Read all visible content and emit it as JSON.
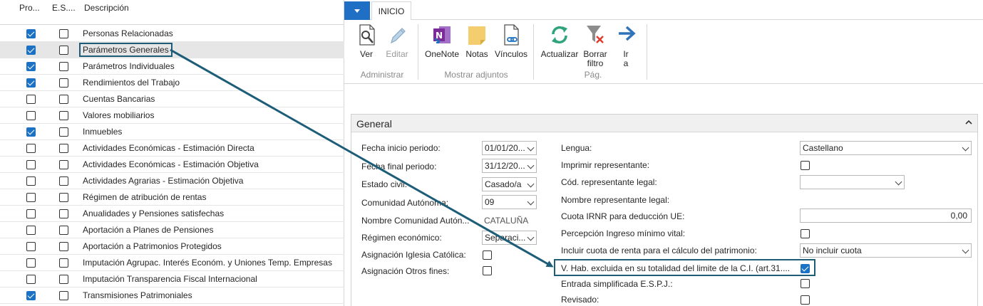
{
  "list": {
    "headers": {
      "col1": "Pro...",
      "col2": "E.S....",
      "col3": "Descripción"
    },
    "rows": [
      {
        "label": "Personas Relacionadas",
        "pro": true,
        "es": false
      },
      {
        "label": "Parámetros Generales",
        "pro": true,
        "es": false,
        "selected": true
      },
      {
        "label": "Parámetros Individuales",
        "pro": true,
        "es": false
      },
      {
        "label": "Rendimientos del Trabajo",
        "pro": true,
        "es": false
      },
      {
        "label": "Cuentas Bancarias",
        "pro": false,
        "es": false
      },
      {
        "label": "Valores mobiliarios",
        "pro": false,
        "es": false
      },
      {
        "label": "Inmuebles",
        "pro": true,
        "es": false
      },
      {
        "label": "Actividades Económicas - Estimación Directa",
        "pro": false,
        "es": false
      },
      {
        "label": "Actividades Económicas - Estimación Objetiva",
        "pro": false,
        "es": false
      },
      {
        "label": "Actividades Agrarias - Estimación Objetiva",
        "pro": false,
        "es": false
      },
      {
        "label": "Régimen de atribución de rentas",
        "pro": false,
        "es": false
      },
      {
        "label": "Anualidades y Pensiones satisfechas",
        "pro": false,
        "es": false
      },
      {
        "label": "Aportación a Planes de Pensiones",
        "pro": false,
        "es": false
      },
      {
        "label": "Aportación a Patrimonios Protegidos",
        "pro": false,
        "es": false
      },
      {
        "label": "Imputación Agrupac. Interés Económ. y Uniones Temp. Empresas",
        "pro": false,
        "es": false
      },
      {
        "label": "Imputación Transparencia Fiscal Internacional",
        "pro": false,
        "es": false
      },
      {
        "label": "Transmisiones Patrimoniales",
        "pro": true,
        "es": false
      }
    ]
  },
  "ribbon": {
    "tab": "INICIO",
    "buttons": {
      "ver": "Ver",
      "editar": "Editar",
      "onenote": "OneNote",
      "notas": "Notas",
      "vinculos": "Vínculos",
      "actualizar": "Actualizar",
      "borrar_filtro_1": "Borrar",
      "borrar_filtro_2": "filtro",
      "ir_a_1": "Ir",
      "ir_a_2": "a"
    },
    "groups": {
      "administrar": "Administrar",
      "adjuntos": "Mostrar adjuntos",
      "pag": "Pág."
    }
  },
  "panel": {
    "title": "General",
    "left": {
      "fecha_inicio": {
        "label": "Fecha inicio periodo:",
        "value": "01/01/20..."
      },
      "fecha_final": {
        "label": "Fecha final periodo:",
        "value": "31/12/20..."
      },
      "estado_civil": {
        "label": "Estado civil:",
        "value": "Casado/a"
      },
      "comunidad": {
        "label": "Comunidad Autónoma:",
        "value": "09"
      },
      "nombre_comunidad": {
        "label": "Nombre Comunidad Autón...",
        "value": "CATALUÑA"
      },
      "regimen": {
        "label": "Régimen económico:",
        "value": "Separaci..."
      },
      "iglesia": {
        "label": "Asignación Iglesia Católica:",
        "checked": false
      },
      "otros": {
        "label": "Asignación Otros fines:",
        "checked": false
      }
    },
    "right": {
      "lengua": {
        "label": "Lengua:",
        "value": "Castellano"
      },
      "imprimir": {
        "label": "Imprimir representante:",
        "checked": false
      },
      "cod_rep": {
        "label": "Cód. representante legal:",
        "value": ""
      },
      "nombre_rep": {
        "label": "Nombre representante legal:"
      },
      "cuota_irnr": {
        "label": "Cuota IRNR para deducción UE:",
        "value": "0,00"
      },
      "percepcion": {
        "label": "Percepción Ingreso mínimo vital:",
        "checked": false
      },
      "incluir_cuota": {
        "label": "Incluir cuota de renta para el cálculo del patrimonio:",
        "value": "No incluir cuota"
      },
      "vhab": {
        "label": "V. Hab. excluida en su totalidad del limite de la C.I. (art.31....",
        "checked": true
      },
      "entrada": {
        "label": "Entrada simplificada E.S.P.J.:",
        "checked": false
      },
      "revisado": {
        "label": "Revisado:",
        "checked": false
      }
    }
  },
  "colors": {
    "accent": "#1b72c4",
    "highlight": "#1d5d78",
    "selected_row": "#e6e6e6"
  },
  "icons": [
    "magnifier-document-icon",
    "pencil-icon",
    "onenote-icon",
    "note-icon",
    "link-document-icon",
    "refresh-icon",
    "clear-filter-icon",
    "arrow-right-icon",
    "chevron-up-icon",
    "chevron-down-icon"
  ]
}
